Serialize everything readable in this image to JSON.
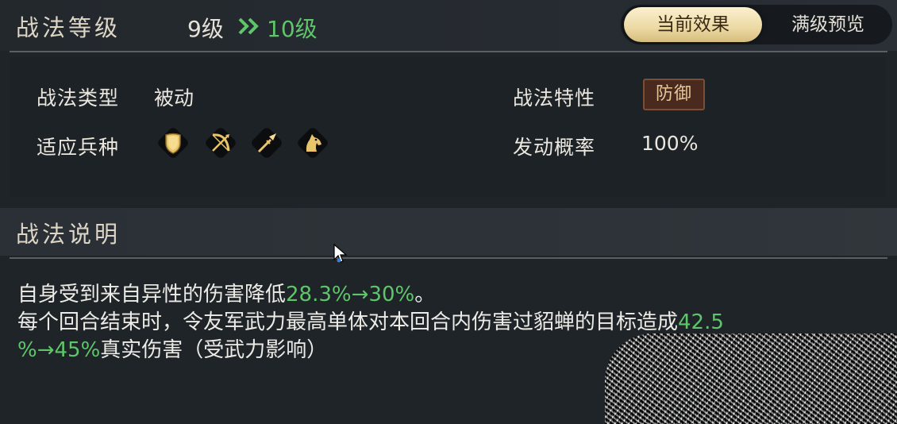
{
  "header": {
    "title": "战法等级",
    "level_current": "9级",
    "level_next": "10级",
    "tabs": [
      {
        "label": "当前效果",
        "active": true
      },
      {
        "label": "满级预览",
        "active": false
      }
    ]
  },
  "attributes": {
    "type_label": "战法类型",
    "type_value": "被动",
    "trait_label": "战法特性",
    "trait_value": "防御",
    "units_label": "适应兵种",
    "units": [
      "shield-icon",
      "bow-icon",
      "spear-icon",
      "horse-icon"
    ],
    "chance_label": "发动概率",
    "chance_value": "100%"
  },
  "description": {
    "title": "战法说明",
    "line1_text": "自身受到来自异性的伤害降低",
    "line1_value": "28.3%→30%",
    "line1_end": "。",
    "line2_text": "每个回合结束时，令友军武力最高单体对本回合内伤害过貂蝉的目标造成",
    "line2_value_a": "42.5",
    "line2_value_b": "%→45%",
    "line2_end": "真实伤害（受武力影响）"
  },
  "colors": {
    "accent_green": "#5fc56a",
    "tab_gold": "#ecd9a3",
    "trait_badge": "#4a2a1f"
  }
}
